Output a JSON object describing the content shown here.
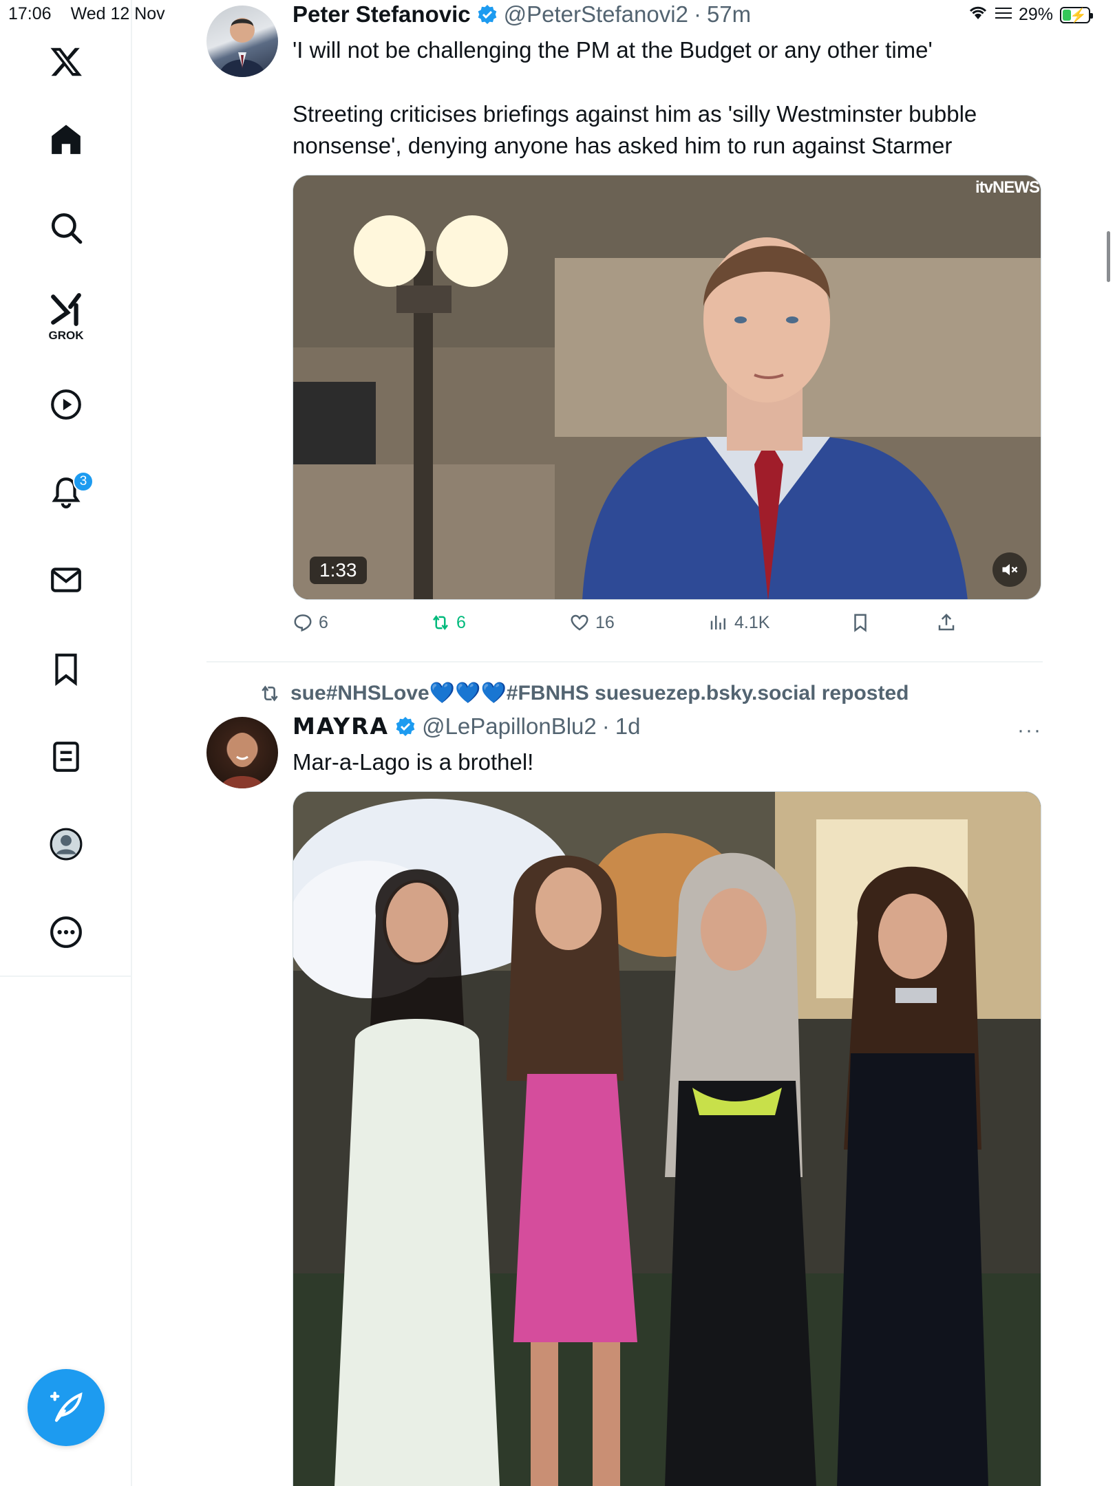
{
  "status_bar": {
    "time": "17:06",
    "date": "Wed 12 Nov",
    "battery": "29%",
    "battery_level": 0.29
  },
  "sidebar": {
    "items": [
      {
        "icon": "x-logo-icon"
      },
      {
        "icon": "home-icon"
      },
      {
        "icon": "search-icon"
      },
      {
        "icon": "grok-icon",
        "label": "GROK"
      },
      {
        "icon": "video-icon"
      },
      {
        "icon": "notifications-icon",
        "badge": "3"
      },
      {
        "icon": "messages-icon"
      },
      {
        "icon": "bookmarks-icon"
      },
      {
        "icon": "lists-icon"
      },
      {
        "icon": "profile-icon"
      },
      {
        "icon": "more-icon"
      }
    ],
    "compose_icon": "compose-icon"
  },
  "tweets": [
    {
      "author_name": "Peter Stefanovic",
      "handle": "@PeterStefanovi2",
      "time": "57m",
      "text_line1": "'I will not be challenging the PM at the Budget or any other time'",
      "text_line2": "Streeting criticises briefings against him as 'silly Westminster bubble nonsense', denying anyone has asked him to run against Starmer",
      "media": {
        "type": "video",
        "duration": "1:33",
        "watermark": "itvNEWS"
      },
      "stats": {
        "replies": "6",
        "reposts": "6",
        "likes": "16",
        "views": "4.1K"
      }
    },
    {
      "repost_by": "sue#NHSLove💙💙💙#FBNHS suesuezep.bsky.social reposted",
      "author_name": "MAYRA",
      "handle": "@LePapillonBlu2",
      "time": "1d",
      "text": "Mar-a-Lago is a brothel!",
      "media": {
        "type": "image"
      }
    }
  ],
  "colors": {
    "accent": "#1d9bf0",
    "repost_green": "#00ba7c",
    "muted_text": "#536471"
  }
}
